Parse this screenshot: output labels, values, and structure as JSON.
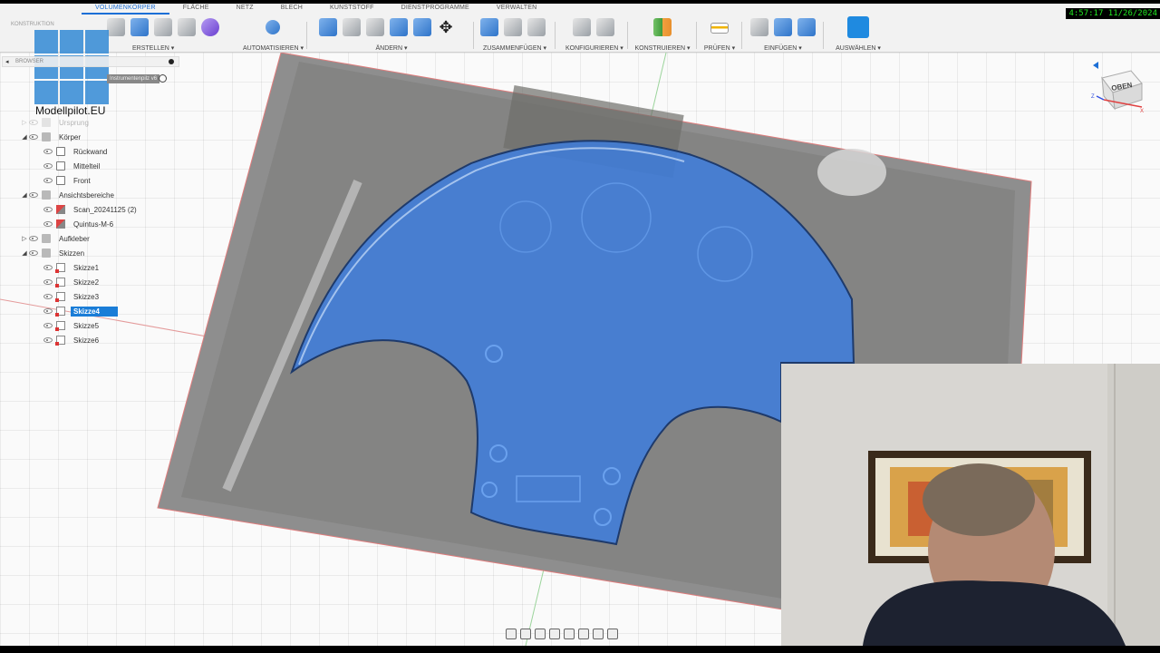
{
  "clock": "4:57:17 11/26/2024",
  "tabs": [
    {
      "label": "VOLUMENKÖRPER",
      "active": true
    },
    {
      "label": "FLÄCHE",
      "active": false
    },
    {
      "label": "NETZ",
      "active": false
    },
    {
      "label": "BLECH",
      "active": false
    },
    {
      "label": "KUNSTSTOFF",
      "active": false
    },
    {
      "label": "DIENSTPROGRAMME",
      "active": false
    },
    {
      "label": "VERWALTEN",
      "active": false
    }
  ],
  "toolbar": {
    "construct_label": "KONSTRUKTION",
    "groups": {
      "erstellen": "ERSTELLEN ▾",
      "automatisieren": "AUTOMATISIEREN ▾",
      "aendern": "ÄNDERN ▾",
      "zusammenfuegen": "ZUSAMMENFÜGEN ▾",
      "konfigurieren": "KONFIGURIEREN ▾",
      "konstruieren": "KONSTRUIEREN ▾",
      "pruefen": "PRÜFEN ▾",
      "einfuegen": "EINFÜGEN ▾",
      "auswaehlen": "AUSWÄHLEN ▾"
    }
  },
  "browser": {
    "title": "BROWSER",
    "logo_text": "Modellpilot.EU",
    "file_tag": "Instrumentenpilz v6",
    "items": [
      {
        "label": "Ursprung",
        "level": 1,
        "type": "folder",
        "twisty": "▷",
        "faded": true
      },
      {
        "label": "Körper",
        "level": 1,
        "type": "folder",
        "twisty": "◢"
      },
      {
        "label": "Rückwand",
        "level": 2,
        "type": "body"
      },
      {
        "label": "Mittelteil",
        "level": 2,
        "type": "body"
      },
      {
        "label": "Front",
        "level": 2,
        "type": "body"
      },
      {
        "label": "Ansichtsbereiche",
        "level": 1,
        "type": "folder",
        "twisty": "◢"
      },
      {
        "label": "Scan_20241125 (2)",
        "level": 2,
        "type": "canvas"
      },
      {
        "label": "Quintus-M-6",
        "level": 2,
        "type": "canvas"
      },
      {
        "label": "Aufkleber",
        "level": 1,
        "type": "folder",
        "twisty": "▷"
      },
      {
        "label": "Skizzen",
        "level": 1,
        "type": "folder",
        "twisty": "◢"
      },
      {
        "label": "Skizze1",
        "level": 2,
        "type": "sketch"
      },
      {
        "label": "Skizze2",
        "level": 2,
        "type": "sketch"
      },
      {
        "label": "Skizze3",
        "level": 2,
        "type": "sketch"
      },
      {
        "label": "Skizze4",
        "level": 2,
        "type": "sketch",
        "selected": true
      },
      {
        "label": "Skizze5",
        "level": 2,
        "type": "sketch"
      },
      {
        "label": "Skizze6",
        "level": 2,
        "type": "sketch"
      }
    ]
  },
  "viewcube": {
    "face": "OBEN",
    "axis_z": "Z",
    "axis_x": "X"
  },
  "colors": {
    "accent": "#1c6fd6",
    "selection_fill": "#3a7de0",
    "clock_green": "#22e622"
  }
}
